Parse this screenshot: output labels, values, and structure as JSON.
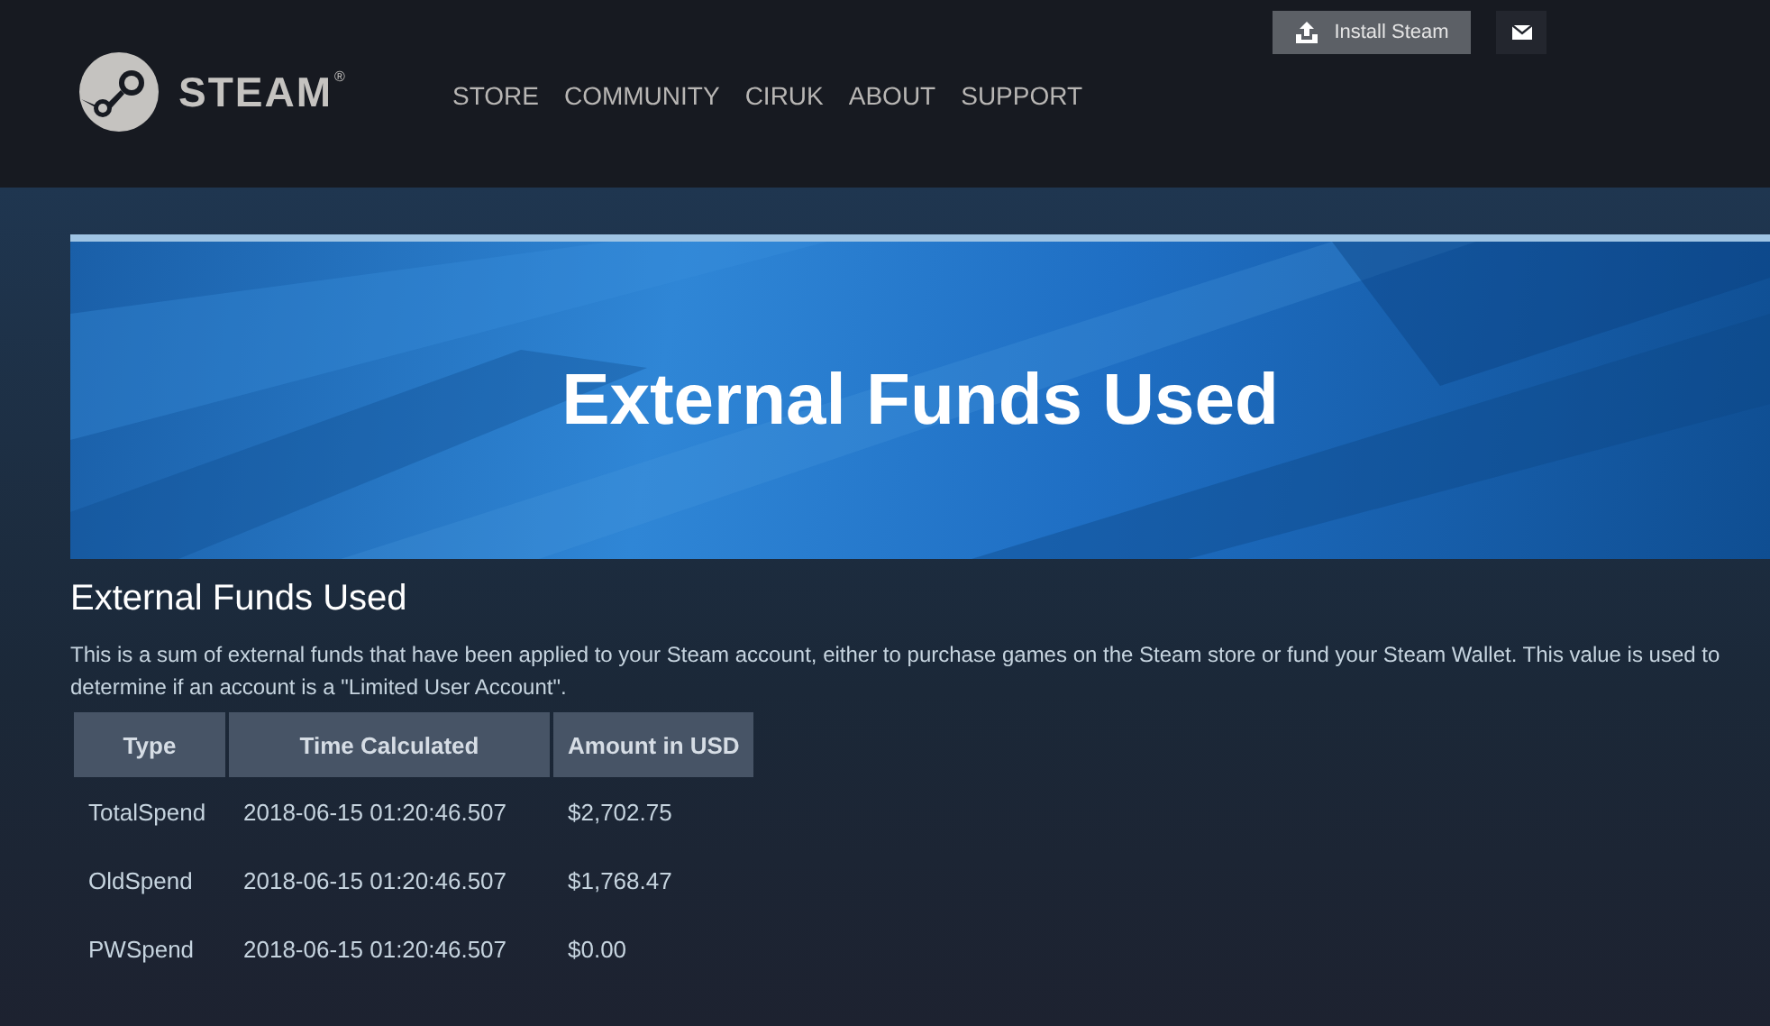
{
  "header": {
    "logo_text": "STEAM",
    "logo_mark": "®",
    "nav": [
      {
        "label": "STORE"
      },
      {
        "label": "COMMUNITY"
      },
      {
        "label": "CIRUK"
      },
      {
        "label": "ABOUT"
      },
      {
        "label": "SUPPORT"
      }
    ],
    "install_button": "Install Steam"
  },
  "banner": {
    "title": "External Funds Used"
  },
  "section": {
    "heading": "External Funds Used",
    "description": "This is a sum of external funds that have been applied to your Steam account, either to purchase games on the Steam store or fund your Steam Wallet. This value is used to determine if an account is a \"Limited User Account\"."
  },
  "table": {
    "columns": [
      "Type",
      "Time Calculated",
      "Amount in USD"
    ],
    "rows": [
      [
        "TotalSpend",
        "2018-06-15 01:20:46.507",
        "$2,702.75"
      ],
      [
        "OldSpend",
        "2018-06-15 01:20:46.507",
        "$1,768.47"
      ],
      [
        "PWSpend",
        "2018-06-15 01:20:46.507",
        "$0.00"
      ]
    ]
  }
}
